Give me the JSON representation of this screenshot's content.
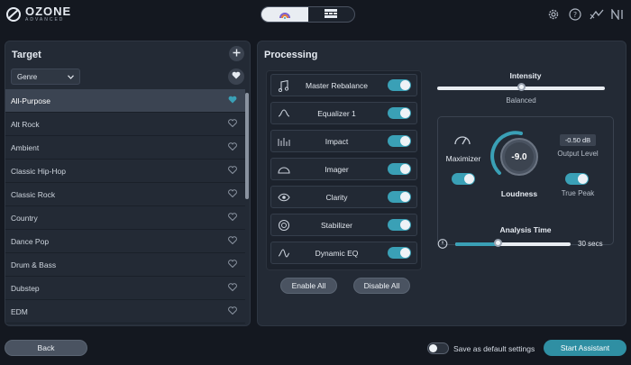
{
  "app": {
    "name": "OZONE",
    "subtitle": "ADVANCED"
  },
  "colors": {
    "accent": "#3aa0b6",
    "panel": "#232a35",
    "background": "#141820"
  },
  "top_icons": [
    "gear-icon",
    "help-icon",
    "signal-icon",
    "ni-logo-icon"
  ],
  "mode_switch": {
    "options": [
      "assistant-icon",
      "modules-icon"
    ],
    "active_index": 0
  },
  "target": {
    "title": "Target",
    "genre_select": "Genre",
    "items": [
      {
        "label": "All-Purpose",
        "selected": true
      },
      {
        "label": "Alt Rock",
        "selected": false
      },
      {
        "label": "Ambient",
        "selected": false
      },
      {
        "label": "Classic Hip-Hop",
        "selected": false
      },
      {
        "label": "Classic Rock",
        "selected": false
      },
      {
        "label": "Country",
        "selected": false
      },
      {
        "label": "Dance Pop",
        "selected": false
      },
      {
        "label": "Drum & Bass",
        "selected": false
      },
      {
        "label": "Dubstep",
        "selected": false
      },
      {
        "label": "EDM",
        "selected": false
      }
    ]
  },
  "processing": {
    "title": "Processing",
    "modules": [
      {
        "label": "Master Rebalance",
        "icon": "master-rebalance-icon",
        "enabled": true
      },
      {
        "label": "Equalizer 1",
        "icon": "equalizer-icon",
        "enabled": true
      },
      {
        "label": "Impact",
        "icon": "impact-icon",
        "enabled": true
      },
      {
        "label": "Imager",
        "icon": "imager-icon",
        "enabled": true
      },
      {
        "label": "Clarity",
        "icon": "clarity-icon",
        "enabled": true
      },
      {
        "label": "Stabilizer",
        "icon": "stabilizer-icon",
        "enabled": true
      },
      {
        "label": "Dynamic EQ",
        "icon": "dynamic-eq-icon",
        "enabled": true
      }
    ],
    "enable_all": "Enable All",
    "disable_all": "Disable All",
    "intensity": {
      "label": "Intensity",
      "value_label": "Balanced",
      "position": 0.5
    },
    "maximizer": {
      "label": "Maximizer",
      "enabled": true
    },
    "loudness": {
      "label": "Loudness",
      "value": "-9.0"
    },
    "output_level": {
      "label": "Output Level",
      "value": "-0.50 dB"
    },
    "true_peak": {
      "label": "True Peak",
      "enabled": true
    },
    "analysis_time": {
      "label": "Analysis Time",
      "value": "30 secs",
      "position": 0.37
    }
  },
  "footer": {
    "back": "Back",
    "save_default": "Save as default settings",
    "save_default_on": false,
    "start": "Start Assistant"
  }
}
